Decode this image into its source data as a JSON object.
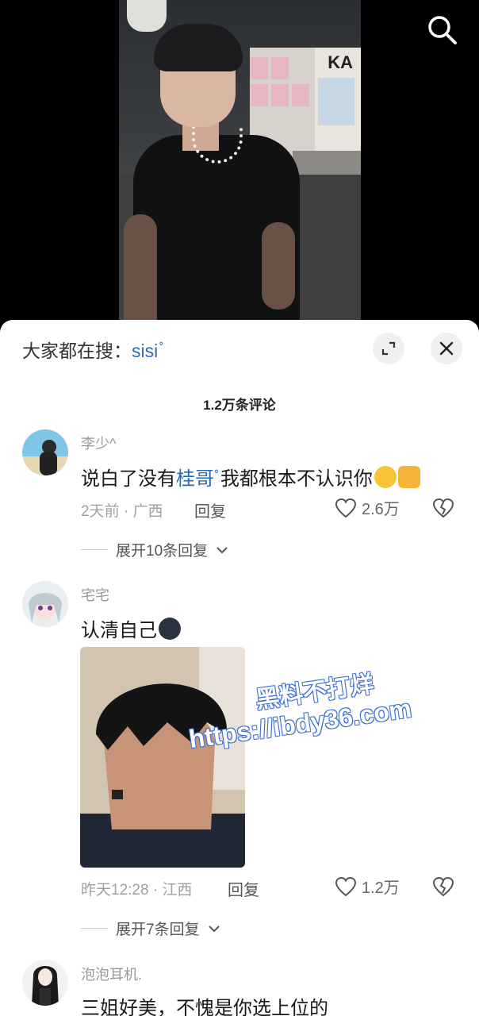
{
  "hot_search": {
    "label": "大家都在搜：",
    "keyword": "sisi"
  },
  "comment_count": "1.2万条评论",
  "comments": [
    {
      "username": "李少^",
      "text_before": "说白了没有",
      "keyword": "桂哥",
      "text_after": "我都根本不认识你",
      "meta": "2天前 · 广西",
      "reply_label": "回复",
      "likes": "2.6万",
      "expand_label": "展开10条回复"
    },
    {
      "username": "宅宅",
      "text": "认清自己",
      "meta": "昨天12:28 · 江西",
      "reply_label": "回复",
      "likes": "1.2万",
      "expand_label": "展开7条回复"
    },
    {
      "username": "泡泡耳机.",
      "text": "三姐好美，不愧是你选上位的"
    }
  ],
  "watermark": {
    "line1": "黑料不打烊",
    "line2": "https://ibdy36.com"
  },
  "video_sign": "KA",
  "colors": {
    "keyword": "#2a6bb5",
    "meta": "#a0a0a0",
    "sheet_bg": "#ffffff"
  }
}
